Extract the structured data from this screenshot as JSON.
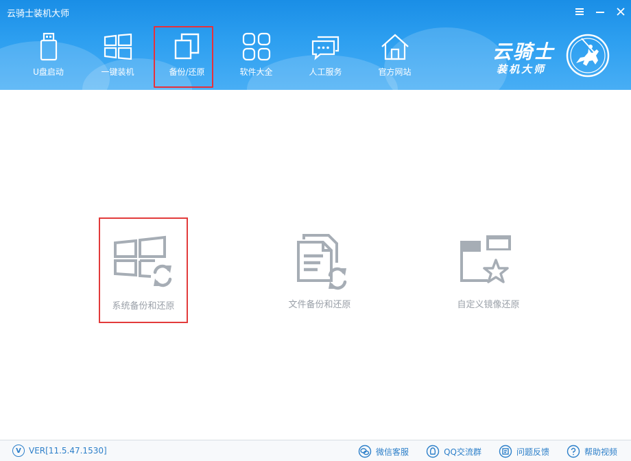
{
  "window": {
    "title": "云骑士装机大师"
  },
  "nav": {
    "items": [
      {
        "label": "U盘启动",
        "icon": "usb-drive-icon"
      },
      {
        "label": "一键装机",
        "icon": "windows-icon"
      },
      {
        "label": "备份/还原",
        "icon": "copy-icon",
        "active": true
      },
      {
        "label": "软件大全",
        "icon": "apps-grid-icon"
      },
      {
        "label": "人工服务",
        "icon": "chat-bubbles-icon"
      },
      {
        "label": "官方网站",
        "icon": "home-icon"
      }
    ]
  },
  "brand": {
    "line1": "云骑士",
    "line2": "装机大师"
  },
  "features": [
    {
      "label": "系统备份和还原",
      "icon": "system-backup-icon",
      "selected": true
    },
    {
      "label": "文件备份和还原",
      "icon": "file-backup-icon"
    },
    {
      "label": "自定义镜像还原",
      "icon": "custom-image-icon"
    }
  ],
  "footer": {
    "version": "VER[11.5.47.1530]",
    "links": [
      {
        "label": "微信客服",
        "icon": "wechat-icon"
      },
      {
        "label": "QQ交流群",
        "icon": "qq-icon"
      },
      {
        "label": "问题反馈",
        "icon": "feedback-icon"
      },
      {
        "label": "帮助视频",
        "icon": "help-icon"
      }
    ]
  },
  "colors": {
    "header_blue": "#2d9ff0",
    "highlight_red": "#e23a3a",
    "link_blue": "#2c7fc9",
    "icon_gray": "#a6adb5"
  }
}
